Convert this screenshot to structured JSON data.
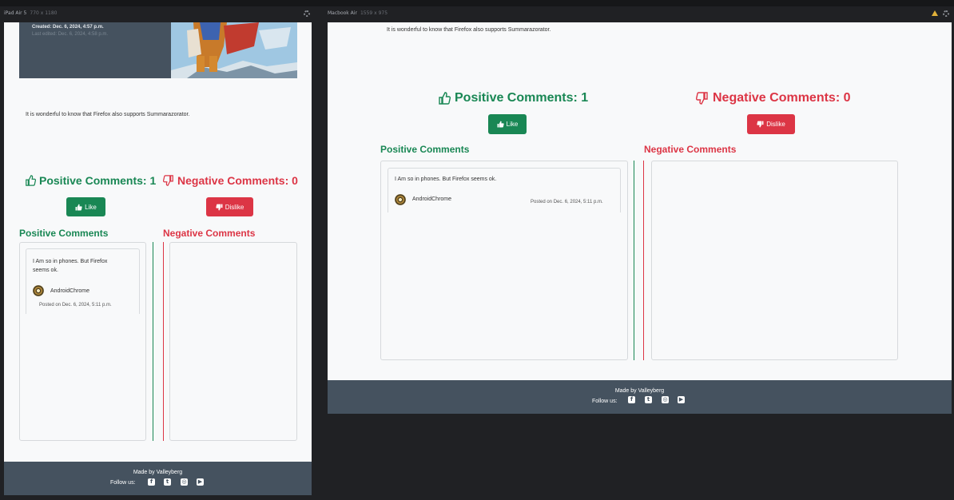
{
  "devices": {
    "left": {
      "name": "iPad Air 5",
      "size": "770 x 1180"
    },
    "right": {
      "name": "Macbook Air",
      "size": "1559 x 975"
    }
  },
  "hero": {
    "created": "Created: Dec. 6, 2024, 4:57 p.m.",
    "last_edited": "Last edited: Dec. 6, 2024, 4:58 p.m."
  },
  "post": {
    "body": "It is wonderful to know that Firefox also supports Summarazorator."
  },
  "votes": {
    "positive_label": "Positive Comments: 1",
    "negative_label": "Negative Comments: 0",
    "like_button": "Like",
    "dislike_button": "Dislike"
  },
  "columns": {
    "positive_heading": "Positive Comments",
    "negative_heading": "Negative Comments"
  },
  "comments": {
    "positive": [
      {
        "text": "I Am so in phones. But Firefox seems ok.",
        "author": "AndroidChrome",
        "posted": "Posted on Dec. 6, 2024, 5:11 p.m."
      }
    ]
  },
  "footer": {
    "made_by": "Made by Valleyberg",
    "follow": "Follow us:",
    "icons": [
      "facebook-icon",
      "twitter-icon",
      "instagram-icon",
      "youtube-icon"
    ]
  },
  "colors": {
    "positive": "#198754",
    "negative": "#dc3545",
    "footer": "#45525f",
    "page": "#f8f9fa"
  }
}
